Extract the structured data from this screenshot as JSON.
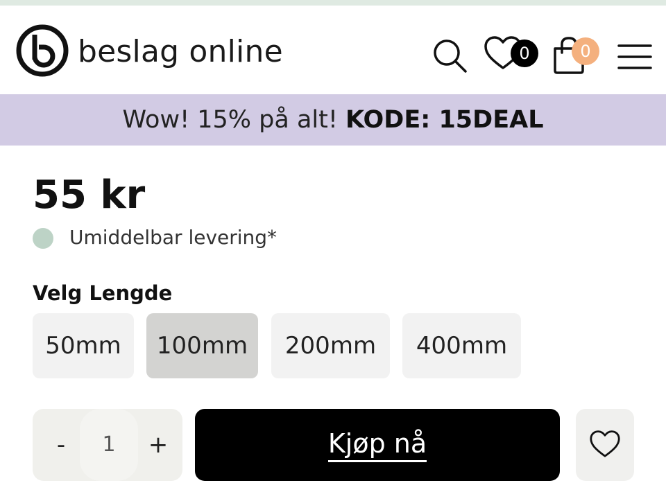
{
  "header": {
    "brand": "beslag online",
    "wishlist_count": "0",
    "cart_count": "0",
    "icons": [
      "logo-icon",
      "search-icon",
      "heart-icon",
      "bag-icon",
      "menu-icon"
    ]
  },
  "promo": {
    "text": "Wow! 15% på alt! ",
    "code": "KODE: 15DEAL"
  },
  "product": {
    "price": "55 kr",
    "delivery": "Umiddelbar levering*",
    "option_label": "Velg Lengde",
    "options": [
      "50mm",
      "100mm",
      "200mm",
      "400mm"
    ],
    "selected_option": "100mm",
    "quantity": "1",
    "qty_minus": "-",
    "qty_plus": "+",
    "buy_label": "Kjøp nå"
  },
  "colors": {
    "promo_bg": "#d2cbe4",
    "top_strip": "#dfeae2",
    "stock_dot": "#bdd3c6",
    "cart_badge": "#f4b07e",
    "wishlist_badge": "#000000",
    "buy_button": "#000000"
  }
}
